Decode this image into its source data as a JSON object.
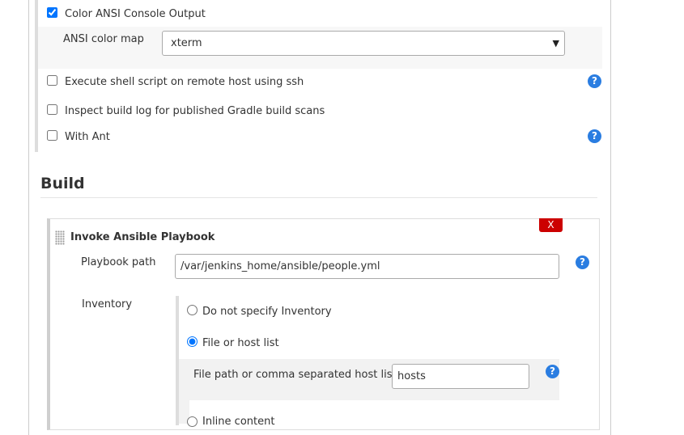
{
  "options": {
    "color_ansi": {
      "label": "Color ANSI Console Output",
      "checked": true
    },
    "ansi_color_map": {
      "label": "ANSI color map",
      "value": "xterm"
    },
    "remote_ssh": {
      "label": "Execute shell script on remote host using ssh",
      "checked": false
    },
    "gradle_scans": {
      "label": "Inspect build log for published Gradle build scans",
      "checked": false
    },
    "with_ant": {
      "label": "With Ant",
      "checked": false
    }
  },
  "help_glyph": "?",
  "build": {
    "section_title": "Build",
    "step": {
      "title": "Invoke Ansible Playbook",
      "delete_label": "X",
      "playbook_label": "Playbook path",
      "playbook_value": "/var/jenkins_home/ansible/people.yml",
      "inventory_label": "Inventory",
      "inventory_options": {
        "none": {
          "label": "Do not specify Inventory",
          "selected": false
        },
        "file": {
          "label": "File or host list",
          "selected": true
        },
        "inline": {
          "label": "Inline content",
          "selected": false
        }
      },
      "host_list_label": "File path or comma separated host list",
      "host_list_value": "hosts"
    }
  },
  "colors": {
    "help_icon": "#2a7de1",
    "delete_button": "#cc0000"
  }
}
